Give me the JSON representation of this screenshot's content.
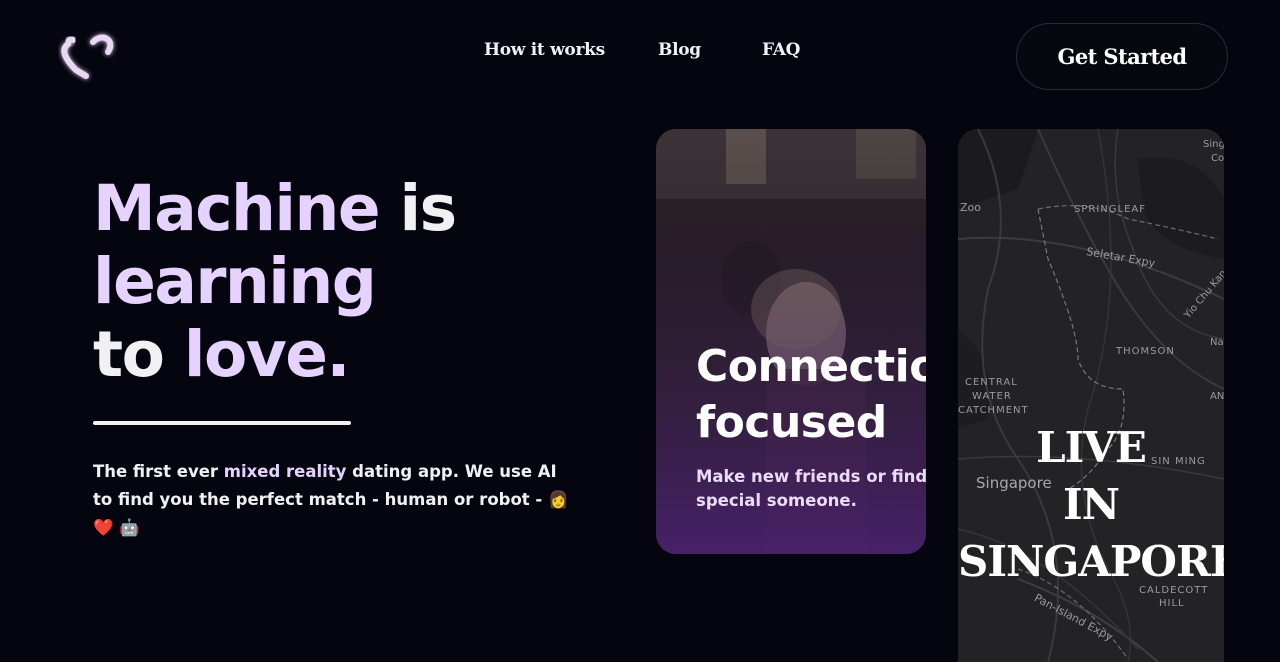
{
  "header": {
    "nav": [
      {
        "label": "How it works"
      },
      {
        "label": "Blog"
      },
      {
        "label": "FAQ"
      }
    ],
    "cta_label": "Get Started"
  },
  "hero": {
    "title_part1": "Machine",
    "title_part2": " is",
    "title_part3": "learning",
    "title_part4": "to ",
    "title_part5": "love.",
    "desc_part1": "The first ever ",
    "desc_part2": "mixed reality",
    "desc_part3": " dating app. We use AI to find you the perfect match - human or robot - ",
    "desc_emoji": "👩 ❤️ 🤖"
  },
  "card": {
    "title_line1": "Connectio",
    "title_line2": "focused",
    "text_line1": "Make new friends or find tha",
    "text_line2": "special someone."
  },
  "map": {
    "live_line1": "LIVE",
    "live_line2": "IN",
    "live_line3": "SINGAPORE",
    "labels": {
      "zoo": "Zoo",
      "springleaf": "SPRINGLEAF",
      "seletar": "Seletar Expy",
      "yio": "Yio Chu Kan",
      "thomson": "THOMSON",
      "central1": "CENTRAL",
      "central2": "WATER",
      "central3": "CATCHMENT",
      "singapore": "Singapore",
      "sinming": "SIN MING",
      "caldecott1": "CALDECOTT",
      "caldecott2": "HILL",
      "pie": "Pan-Island Expy",
      "sing": "Sing",
      "co": "Co",
      "na": "Na",
      "an": "AN"
    }
  },
  "colors": {
    "background": "#05050f",
    "accent_lavender": "#e6d2ff",
    "card_purple": "#4b2170"
  }
}
